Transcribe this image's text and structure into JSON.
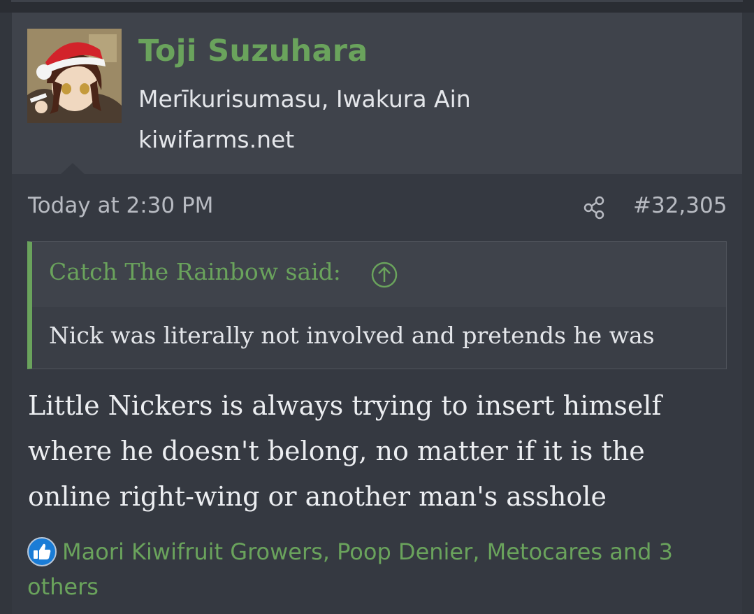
{
  "colors": {
    "accent": "#6aa35c",
    "background": "#32363d",
    "header_background": "#3f434b",
    "text": "#e4e6ea",
    "muted_text": "#b8bbc2",
    "like_blue": "#1a7cd6"
  },
  "user": {
    "avatar_icon": "avatar-icon",
    "name": "Toji Suzuhara",
    "title": "Merīkurisumasu, Iwakura Ain",
    "site": "kiwifarms.net"
  },
  "post": {
    "date": "Today at 2:30 PM",
    "share_icon": "share-icon",
    "number": "#32,305",
    "quote": {
      "author": "Catch The Rainbow said:",
      "jump_icon": "arrow-up-circle-icon",
      "text": "Nick was literally not involved and pretends he was"
    },
    "message_lines": [
      "Little Nickers is always trying to insert himself",
      "where he doesn't belong, no matter if it is the",
      "online right-wing or another man's asshole"
    ],
    "reactions": {
      "icon": "like-icon",
      "text": "Maori Kiwifruit Growers, Poop Denier, Metocares and 3 others"
    }
  }
}
